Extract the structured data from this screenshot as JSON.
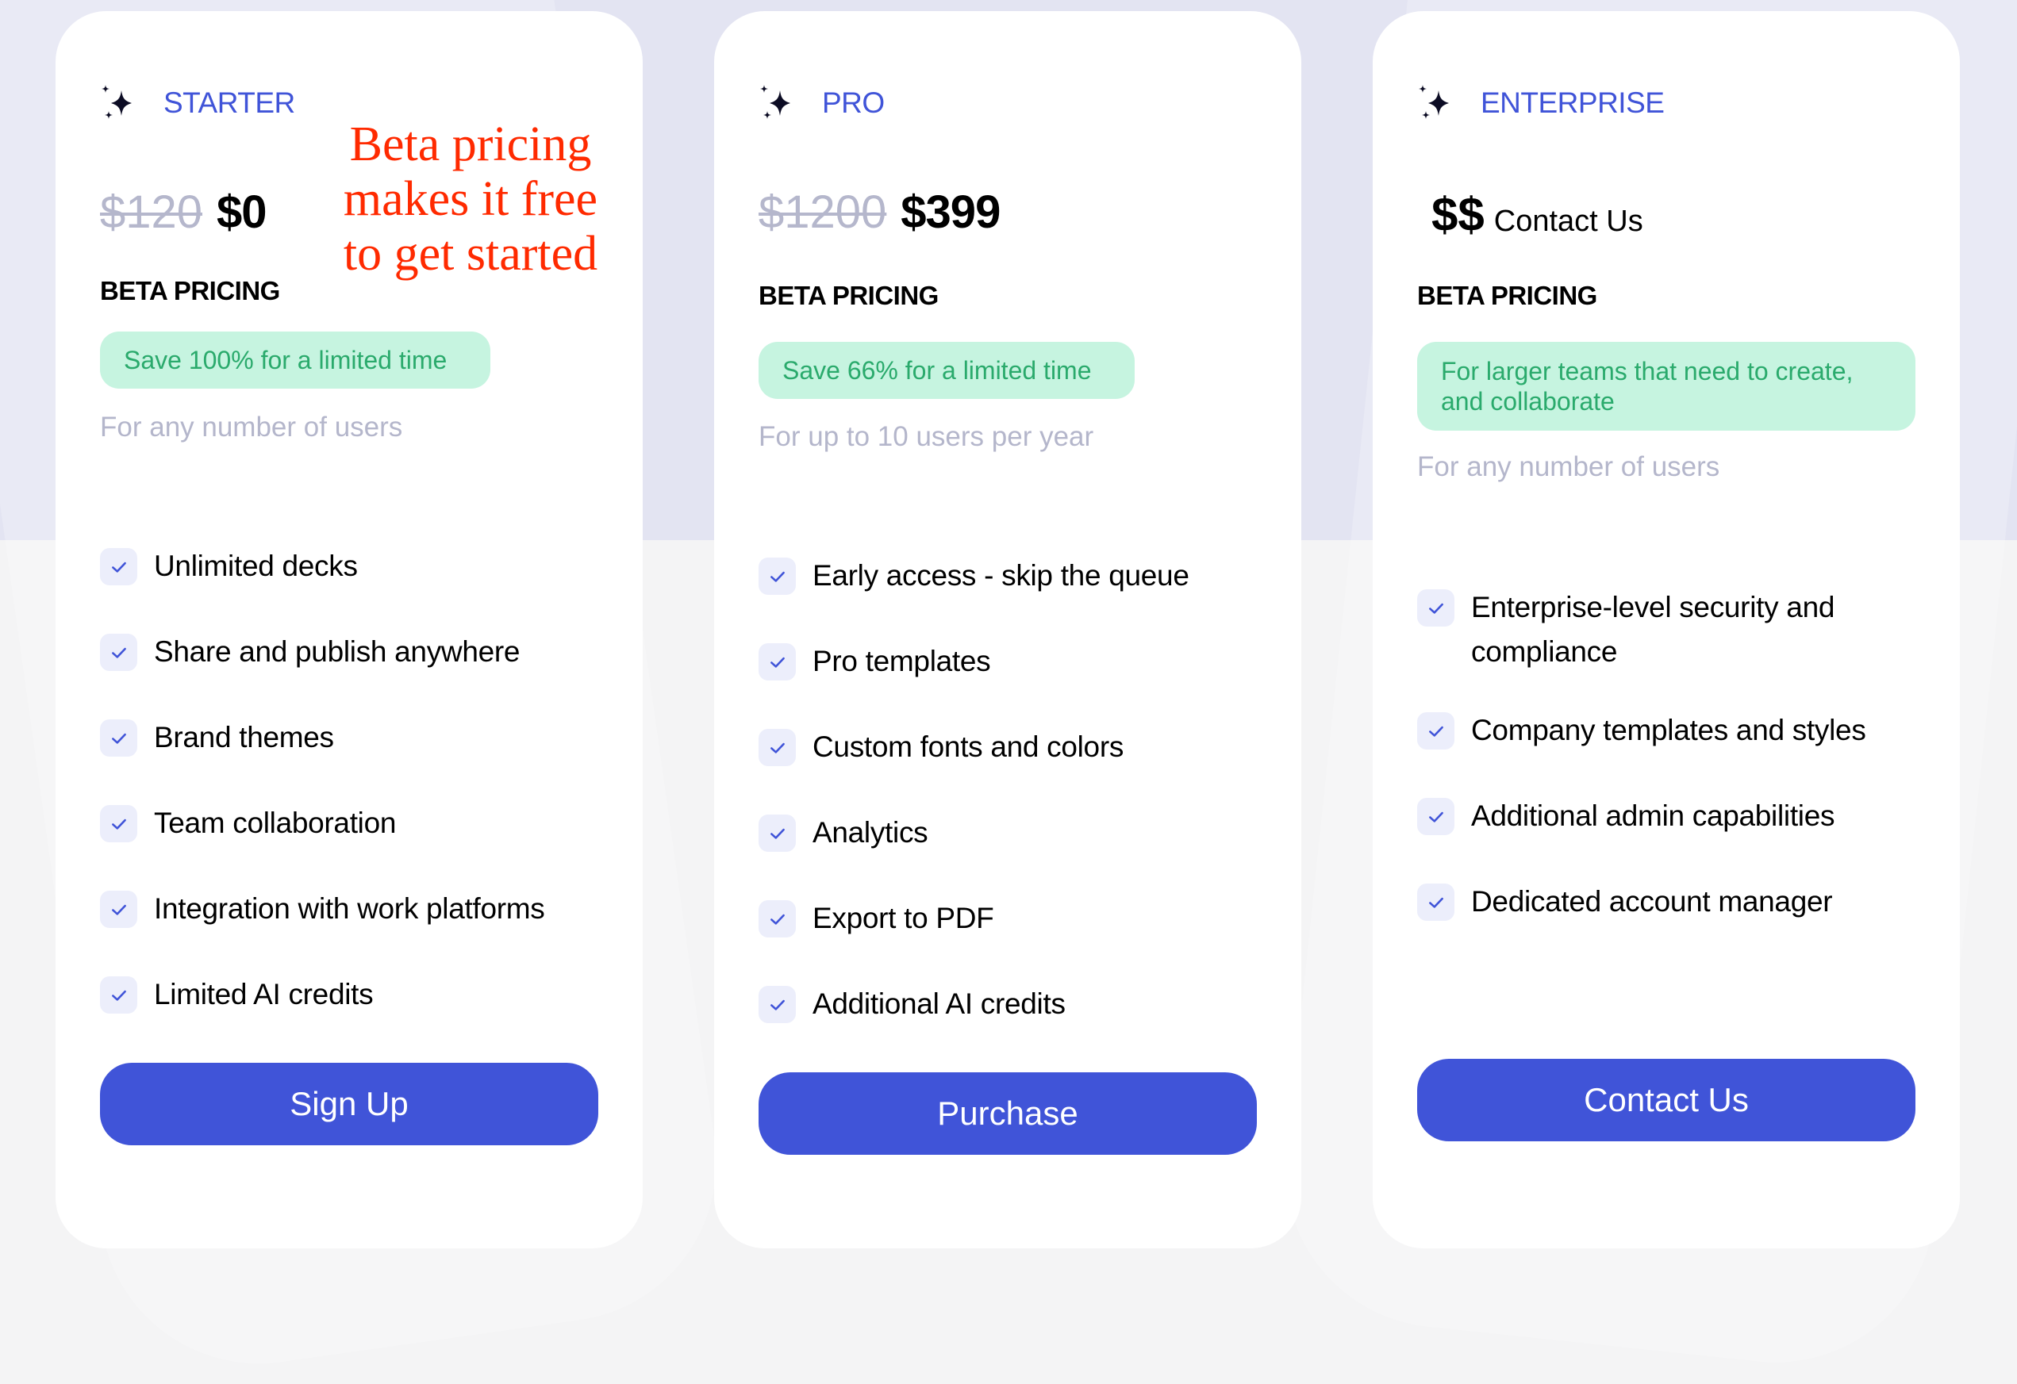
{
  "theme": {
    "accent": "#4054d8",
    "badge_bg": "#c6f4e0",
    "badge_text": "#2aaa6c",
    "muted_text": "#b4b6cb",
    "annotation_color": "#ff2a00"
  },
  "annotation": {
    "text": "Beta pricing makes it free to get started"
  },
  "plans": [
    {
      "icon": "sparkles-icon",
      "name": "STARTER",
      "old_price": "$120",
      "price": "$0",
      "pricing_label": "BETA PRICING",
      "badge": "Save 100% for a limited time",
      "users": "For any number of users",
      "features": [
        "Unlimited decks",
        "Share and publish anywhere",
        "Brand themes",
        "Team collaboration",
        "Integration with work platforms",
        "Limited AI credits"
      ],
      "cta": "Sign Up"
    },
    {
      "icon": "sparkles-icon",
      "name": "PRO",
      "old_price": "$1200",
      "price": "$399",
      "pricing_label": "BETA PRICING",
      "badge": "Save 66% for a limited time",
      "users": "For up to 10 users per year",
      "features": [
        "Early access - skip the queue",
        "Pro templates",
        "Custom fonts and colors",
        "Analytics",
        "Export to PDF",
        "Additional AI credits"
      ],
      "cta": "Purchase"
    },
    {
      "icon": "sparkles-icon",
      "name": "ENTERPRISE",
      "price_symbol": "$$",
      "price_text": "Contact Us",
      "pricing_label": "BETA PRICING",
      "badge": "For larger teams that need to create, and collaborate",
      "users": "For any number of users",
      "features": [
        "Enterprise-level security and compliance",
        "Company templates and styles",
        "Additional admin capabilities",
        "Dedicated account manager"
      ],
      "cta": "Contact Us"
    }
  ]
}
